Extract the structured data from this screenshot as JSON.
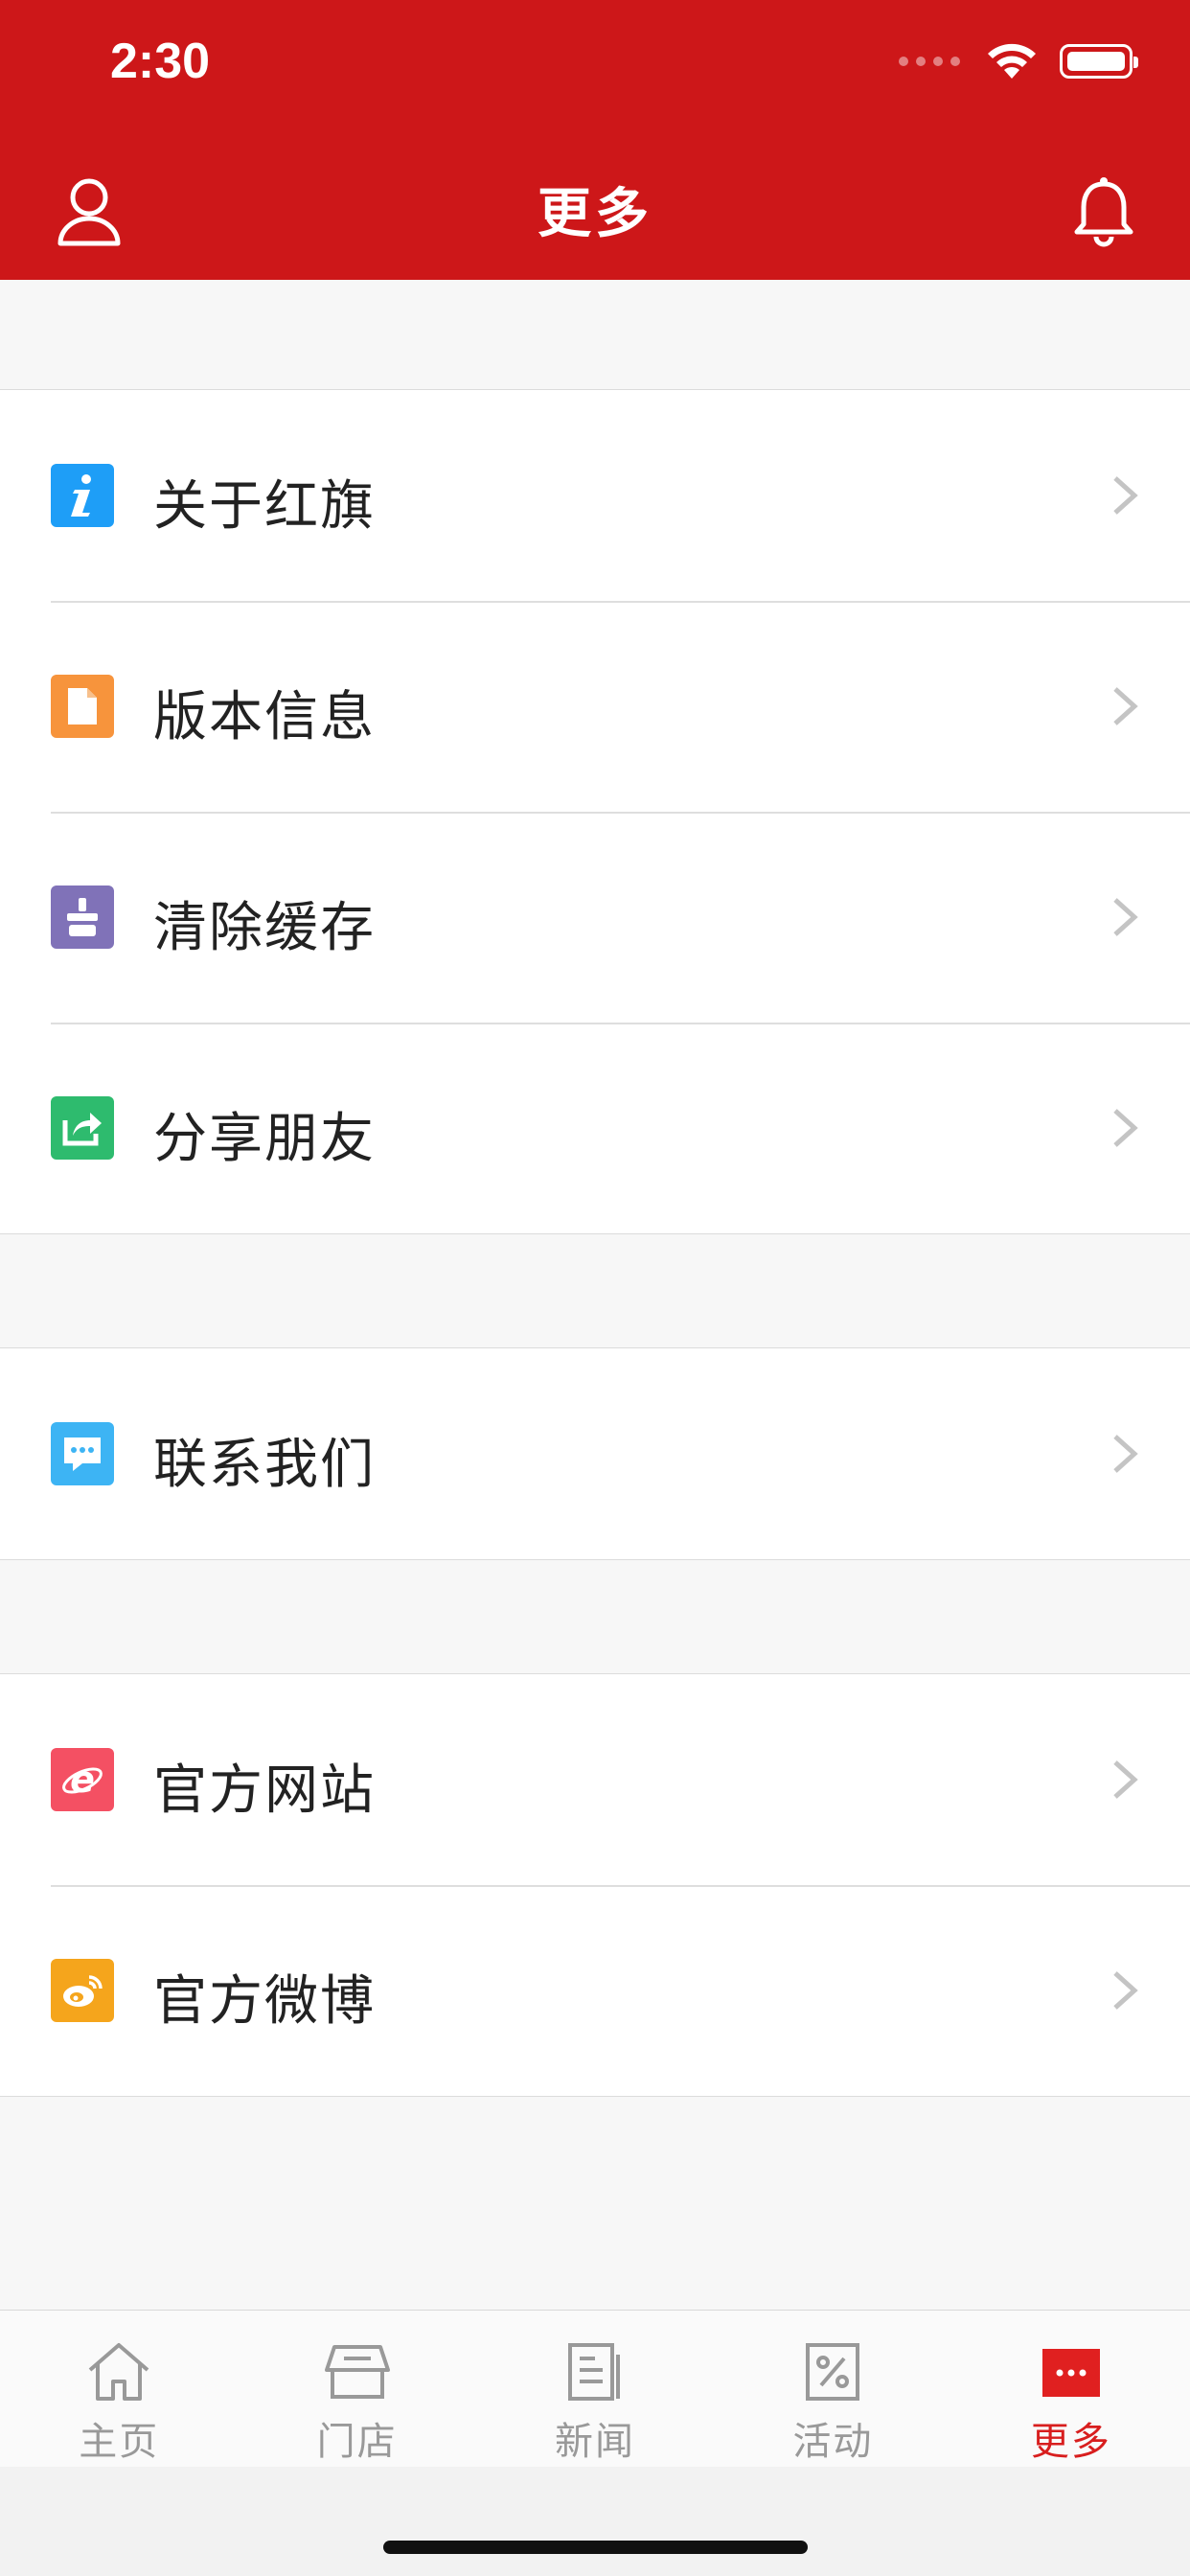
{
  "status": {
    "time": "2:30"
  },
  "header": {
    "title": "更多"
  },
  "sections": [
    {
      "items": [
        {
          "label": "关于红旗",
          "icon": "info-icon",
          "color": "#1e9ef7"
        },
        {
          "label": "版本信息",
          "icon": "document-icon",
          "color": "#f7943c"
        },
        {
          "label": "清除缓存",
          "icon": "broom-icon",
          "color": "#8072b8"
        },
        {
          "label": "分享朋友",
          "icon": "share-icon",
          "color": "#2ebb6e"
        }
      ]
    },
    {
      "items": [
        {
          "label": "联系我们",
          "icon": "chat-icon",
          "color": "#3db4f4"
        }
      ]
    },
    {
      "items": [
        {
          "label": "官方网站",
          "icon": "browser-icon",
          "color": "#f45063"
        },
        {
          "label": "官方微博",
          "icon": "weibo-icon",
          "color": "#f5a51c"
        }
      ]
    }
  ],
  "tabbar": {
    "tabs": [
      {
        "label": "主页",
        "icon": "home-icon"
      },
      {
        "label": "门店",
        "icon": "store-icon"
      },
      {
        "label": "新闻",
        "icon": "news-icon"
      },
      {
        "label": "活动",
        "icon": "discount-icon"
      },
      {
        "label": "更多",
        "icon": "more-icon",
        "active": true
      }
    ],
    "active_color": "#d81e1e",
    "inactive_color": "#999999"
  },
  "colors": {
    "header_bg": "#cd1719",
    "page_bg": "#f7f7f7"
  }
}
